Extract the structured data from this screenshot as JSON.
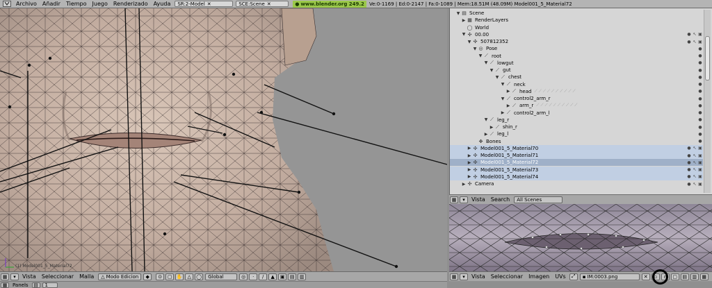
{
  "topbar": {
    "menus": [
      "Archivo",
      "Añadir",
      "Tiempo",
      "Juego",
      "Renderizado",
      "Ayuda"
    ],
    "screen_field": "SR:2-Model",
    "scene_field": "SCE:Scene",
    "website": "www.blender.org 249.2",
    "stats": "Ve:0-1169 | Ed:0-2147 | Fa:0-1089 | Mem:18.51M (48.09M) Model001_5_Material72"
  },
  "viewport": {
    "object_name": "(1) Model001_5_Material72",
    "header": {
      "menus": [
        "Vista",
        "Seleccionar",
        "Malla"
      ],
      "mode": "Modo Edicion",
      "orientation": "Global"
    },
    "sub_header": {
      "panels_label": "Panels",
      "frame": "1"
    }
  },
  "outliner": {
    "rows": [
      {
        "label": "Scene",
        "level": 0,
        "expand": "down",
        "icon": "scene-icon"
      },
      {
        "label": "RenderLayers",
        "level": 1,
        "expand": "right",
        "icon": "renderlayers-icon"
      },
      {
        "label": "World",
        "level": 1,
        "expand": "",
        "icon": "world-icon"
      },
      {
        "label": "00.00",
        "level": 1,
        "expand": "down",
        "icon": "armature-icon"
      },
      {
        "label": "507812352",
        "level": 2,
        "expand": "down",
        "icon": "armature-data-icon"
      },
      {
        "label": "Pose",
        "level": 3,
        "expand": "down",
        "icon": "pose-icon"
      },
      {
        "label": "root",
        "level": 4,
        "expand": "down",
        "icon": "bone-icon"
      },
      {
        "label": "lowgut",
        "level": 5,
        "expand": "down",
        "icon": "bone-icon"
      },
      {
        "label": "gut",
        "level": 6,
        "expand": "down",
        "icon": "bone-icon"
      },
      {
        "label": "chest",
        "level": 7,
        "expand": "down",
        "icon": "bone-icon"
      },
      {
        "label": "neck",
        "level": 8,
        "expand": "down",
        "icon": "bone-icon"
      },
      {
        "label": "head",
        "level": 9,
        "expand": "right",
        "icon": "bone-icon"
      },
      {
        "label": "control2_arm_r",
        "level": 8,
        "expand": "down",
        "icon": "bone-icon"
      },
      {
        "label": "arm_r",
        "level": 9,
        "expand": "right",
        "icon": "bone-icon"
      },
      {
        "label": "control2_arm_l",
        "level": 8,
        "expand": "right",
        "icon": "bone-icon"
      },
      {
        "label": "leg_r",
        "level": 5,
        "expand": "down",
        "icon": "bone-icon"
      },
      {
        "label": "shin_r",
        "level": 6,
        "expand": "right",
        "icon": "bone-icon"
      },
      {
        "label": "leg_l",
        "level": 5,
        "expand": "right",
        "icon": "bone-icon"
      },
      {
        "label": "Bones",
        "level": 3,
        "expand": "",
        "icon": "bones-icon"
      },
      {
        "label": "Model001_5_Material70",
        "level": 2,
        "expand": "right",
        "icon": "mesh-icon"
      },
      {
        "label": "Model001_5_Material71",
        "level": 2,
        "expand": "right",
        "icon": "mesh-icon"
      },
      {
        "label": "Model001_5_Material72",
        "level": 2,
        "expand": "right",
        "icon": "mesh-icon"
      },
      {
        "label": "Model001_5_Material73",
        "level": 2,
        "expand": "right",
        "icon": "mesh-icon"
      },
      {
        "label": "Model001_5_Material74",
        "level": 2,
        "expand": "right",
        "icon": "mesh-icon"
      },
      {
        "label": "Camera",
        "level": 1,
        "expand": "right",
        "icon": "camera-icon"
      }
    ],
    "header": {
      "menus": [
        "Vista",
        "Search"
      ],
      "filter": "All Scenes"
    }
  },
  "image_editor": {
    "header": {
      "menus": [
        "Vista",
        "Seleccionar",
        "Imagen",
        "UVs"
      ],
      "image_name": "IM:0003.png"
    }
  },
  "colors": {
    "viewport_bg": "#959595",
    "outliner_bg": "#d6d6d6",
    "header_bg": "#a7a7a7",
    "selected_row": "#c1cfe3",
    "active_row": "#9fb0c8",
    "website_green": "#9bc84a"
  }
}
